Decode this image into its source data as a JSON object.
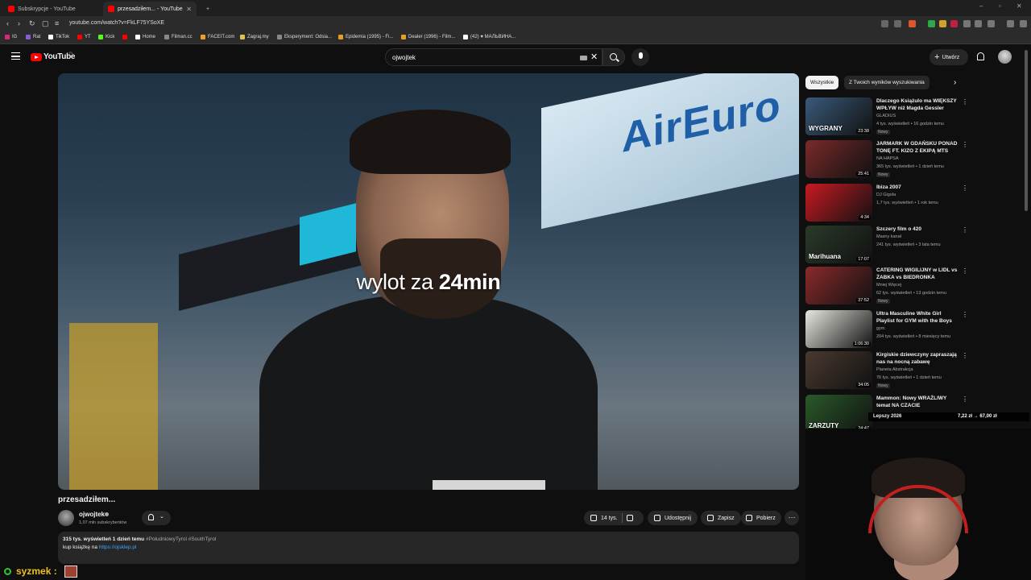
{
  "browser": {
    "tabs": [
      {
        "title": "Subskrypcje - YouTube"
      },
      {
        "title": "przesadziłem... - YouTube"
      }
    ],
    "new_tab": "+",
    "window_controls": [
      "–",
      "▫",
      "✕"
    ],
    "url": "youtube.com/watch?v=FkLF75YSoXE",
    "bookmarks": [
      "IG",
      "Rat",
      "TikTok",
      "YT",
      "Kick",
      "Home",
      "Filman.cc",
      "FACEIT.com",
      "Zagraj.my",
      "Eksperyment: Odsia...",
      "Epidemia (1995) - Fi...",
      "Dealer (1996) - Film...",
      "(42) ♥ МАЛЬВИНА..."
    ]
  },
  "header": {
    "logo": "YouTube",
    "logo_country": "PL",
    "search_value": "ojwojtek",
    "clear": "✕",
    "create_label": "Utwórz",
    "create_plus": "+"
  },
  "video": {
    "overlay_prefix": "wylot za ",
    "overlay_bold": "24min",
    "sign_text": "AirEuro",
    "title": "przesadziłem...",
    "channel": "ojwojtek",
    "subscribers": "1,07 mln subskrybentów",
    "bell_chevron": "⌄",
    "likes": "14 tys.",
    "share": "Udostępnij",
    "save": "Zapisz",
    "download": "Pobierz",
    "more": "⋯",
    "description": {
      "meta": "315 tys. wyświetleń  1 dzień temu",
      "tags": " #PołudniowyTyrol #SouthTyrol",
      "line2_prefix": "kup książkę na ",
      "link": "https://ojsklep.pl"
    }
  },
  "sidebar": {
    "chips": [
      "Wszystkie",
      "Z Twoich wyników wyszukiwania"
    ],
    "chip_next": "›",
    "recommendations": [
      {
        "title": "Dlaczego Książulo ma WIĘKSZY WPŁYW niż Magda Gessler",
        "channel": "GLADIUS",
        "stats": "4 tys. wyświetleń • 16 godzin temu",
        "badge": "Nowy",
        "duration": "23:38",
        "thumb_text": "WYGRANY",
        "thumb_color": "#3a5a7a"
      },
      {
        "title": "JARMARK W GDAŃSKU PONAD TONĘ FT. KIZO Z EKIPĄ MTS",
        "channel": "NA HAPSA",
        "stats": "365 tys. wyświetleń • 1 dzień temu",
        "badge": "Nowy",
        "duration": "25:41",
        "thumb_text": "",
        "thumb_color": "#7a2a2a"
      },
      {
        "title": "Ibiza 2007",
        "channel": "DJ Gigola",
        "stats": "1,7 tys. wyświetleń • 1 rok temu",
        "badge": "",
        "duration": "4:34",
        "thumb_text": "",
        "thumb_color": "#c81a22"
      },
      {
        "title": "Szczery film o 420",
        "channel": "Masny kanał",
        "stats": "241 tys. wyświetleń • 3 lata temu",
        "badge": "",
        "duration": "17:07",
        "thumb_text": "Marihuana",
        "thumb_color": "#2a3a2a"
      },
      {
        "title": "CATERING WIGILIJNY w LIDL vs ŻABKA vs BIEDRONKA",
        "channel": "Mniej Więcej",
        "stats": "62 tys. wyświetleń • 13 godzin temu",
        "badge": "Nowy",
        "duration": "37:52",
        "thumb_text": "",
        "thumb_color": "#8a2a2a"
      },
      {
        "title": "Ultra Masculine White Girl Playlist for GYM with the Boys",
        "channel": "gym.",
        "stats": "204 tys. wyświetleń • 8 miesięcy temu",
        "badge": "",
        "duration": "1:06:30",
        "thumb_text": "",
        "thumb_color": "#e8e8e0"
      },
      {
        "title": "Kirgiskie dziewczyny zapraszają nas na nocną zabawę",
        "channel": "Planeta Abstrakcja",
        "stats": "76 tys. wyświetleń • 1 dzień temu",
        "badge": "Nowy",
        "duration": "34:05",
        "thumb_text": "",
        "thumb_color": "#4a3a30"
      },
      {
        "title": "Mammon: Nowy WRAŻLIWY temat NA CZACIE",
        "channel": "",
        "stats": "",
        "badge": "",
        "duration": "24:47",
        "thumb_text": "ZARZUTY",
        "thumb_color": "#2a5a2a"
      }
    ],
    "kebab": "⋮"
  },
  "stream_overlay": {
    "ticker_title": "Lepszy 2026",
    "ticker_price": "7,22 zł → 67,00 zł",
    "chat_user": "syzmek :"
  }
}
